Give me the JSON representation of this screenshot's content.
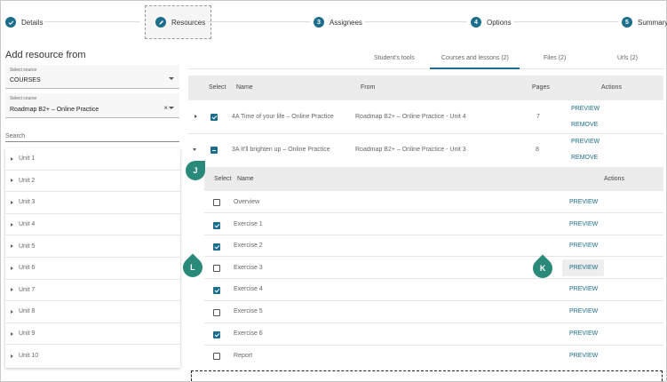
{
  "stepper": {
    "steps": [
      {
        "label": "Details",
        "marker": "check-icon"
      },
      {
        "label": "Resources",
        "marker": "pencil-icon"
      },
      {
        "label": "Assignees",
        "marker": "3"
      },
      {
        "label": "Options",
        "marker": "4"
      },
      {
        "label": "Summary",
        "marker": "5"
      }
    ]
  },
  "left": {
    "title": "Add resource from",
    "source": {
      "label": "Select source",
      "value": "COURSES"
    },
    "course": {
      "label": "Select course",
      "value": "Roadmap B2+ – Online Practice",
      "clear": "×"
    },
    "search_label": "Search",
    "units": [
      "Unit 1",
      "Unit 2",
      "Unit 3",
      "Unit 4",
      "Unit 5",
      "Unit 6",
      "Unit 7",
      "Unit 8",
      "Unit 9",
      "Unit 10"
    ]
  },
  "tabs": [
    "Student's tools",
    "Courses and lessons (2)",
    "Files (2)",
    "Urls (2)"
  ],
  "table": {
    "headers": {
      "select": "Select",
      "name": "Name",
      "from": "From",
      "pages": "Pages",
      "actions": "Actions"
    },
    "rows": [
      {
        "name": "4A Time of your life – Online Practice",
        "from": "Roadmap B2+ – Online Practice - Unit 4",
        "pages": "7",
        "preview": "PREVIEW",
        "remove": "REMOVE"
      },
      {
        "name": "3A It'll brighten up – Online Practice",
        "from": "Roadmap B2+ – Online Practice - Unit 3",
        "pages": "8",
        "preview": "PREVIEW",
        "remove": "REMOVE"
      }
    ]
  },
  "subtable": {
    "headers": {
      "select": "Select",
      "name": "Name",
      "actions": "Actions"
    },
    "rows": [
      {
        "name": "Overview",
        "checked": false,
        "preview": "PREVIEW"
      },
      {
        "name": "Exercise 1",
        "checked": true,
        "preview": "PREVIEW"
      },
      {
        "name": "Exercise 2",
        "checked": true,
        "preview": "PREVIEW"
      },
      {
        "name": "Exercise 3",
        "checked": false,
        "preview": "PREVIEW"
      },
      {
        "name": "Exercise 4",
        "checked": true,
        "preview": "PREVIEW"
      },
      {
        "name": "Exercise 5",
        "checked": false,
        "preview": "PREVIEW"
      },
      {
        "name": "Exercise 6",
        "checked": true,
        "preview": "PREVIEW"
      },
      {
        "name": "Report",
        "checked": false,
        "preview": "PREVIEW"
      }
    ]
  },
  "callouts": {
    "j": "J",
    "k": "K",
    "l": "L"
  },
  "colors": {
    "accent": "#1d6e8c",
    "callout": "#2a8a7a"
  }
}
